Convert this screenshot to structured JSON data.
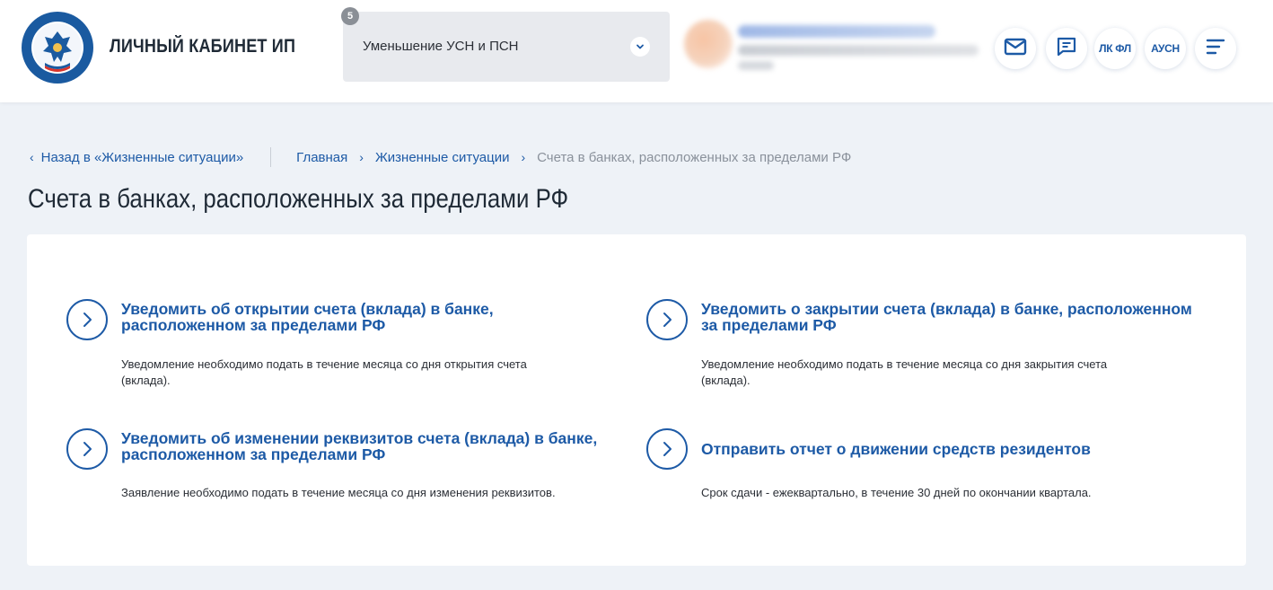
{
  "colors": {
    "accent": "#1d5aa6",
    "page_bg": "#eef2f7",
    "muted_text": "#8a919b"
  },
  "header": {
    "logo_icon": "fns-emblem-icon",
    "brand_title": "ЛИЧНЫЙ КАБИНЕТ ИП",
    "mode_select": {
      "badge": "5",
      "label": "Уменьшение УСН и ПСН",
      "icon": "chevron-down-icon"
    },
    "buttons": {
      "mail_icon": "mail-icon",
      "messages_icon": "chat-icon",
      "lk_fl_label": "ЛК ФЛ",
      "ausn_label": "АУСН",
      "menu_icon": "hamburger-menu-icon"
    }
  },
  "breadcrumbs": {
    "back_label": "Назад в «Жизненные ситуации»",
    "items": [
      "Главная",
      "Жизненные ситуации"
    ],
    "current": "Счета в банках, расположенных за пределами РФ"
  },
  "page_title": "Счета в банках, расположенных за пределами РФ",
  "actions": [
    {
      "title_line1": "Уведомить об открытии счета (вклада) в банке,",
      "title_line2": "расположенном за пределами РФ",
      "desc_line1": "Уведомление необходимо подать в течение месяца со дня открытия счета",
      "desc_line2": "(вклада).",
      "icon": "chevron-right-circle-icon"
    },
    {
      "title_line1": "Уведомить о закрытии счета (вклада) в банке, расположенном",
      "title_line2": "за пределами РФ",
      "desc_line1": "Уведомление необходимо подать в течение месяца со дня закрытия счета",
      "desc_line2": "(вклада).",
      "icon": "chevron-right-circle-icon"
    },
    {
      "title_line1": "Уведомить об изменении реквизитов счета (вклада) в банке,",
      "title_line2": "расположенном за пределами РФ",
      "desc_line1": "Заявление необходимо подать в течение месяца со дня изменения реквизитов.",
      "desc_line2": "",
      "icon": "chevron-right-circle-icon"
    },
    {
      "title_line1": "Отправить отчет о движении средств резидентов",
      "title_line2": "",
      "desc_line1": "Срок сдачи - ежеквартально, в течение 30 дней по окончании квартала.",
      "desc_line2": "",
      "icon": "chevron-right-circle-icon"
    }
  ]
}
